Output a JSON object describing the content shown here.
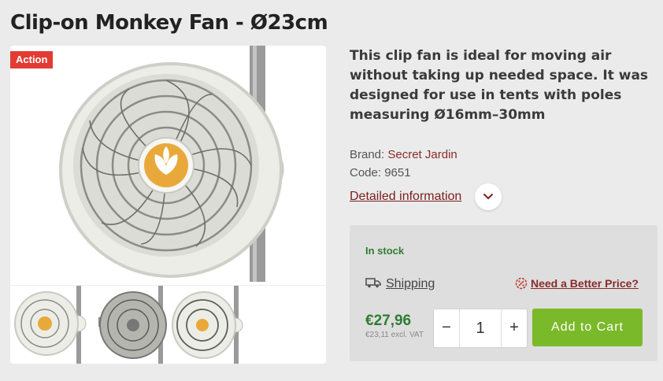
{
  "product": {
    "title": "Clip-on Monkey Fan - Ø23cm",
    "badge": "Action",
    "description": "This clip fan is ideal for moving air without taking up needed space. It was designed for use in tents with poles measuring Ø16mm–30mm",
    "brand_label": "Brand:",
    "brand_value": "Secret Jardin",
    "code_label": "Code:",
    "code_value": "9651",
    "details_label": "Detailed information"
  },
  "buybox": {
    "stock": "In stock",
    "shipping_label": "Shipping",
    "better_price_label": "Need a Better Price?",
    "price": "€27,96",
    "price_excl": "€23,11 excl. VAT",
    "quantity": "1",
    "minus": "−",
    "plus": "+",
    "cart_label": "Add to Cart"
  },
  "colors": {
    "badge": "#e23b34",
    "cart": "#7ab929",
    "price": "#2e7d32",
    "link": "#8b2a2a"
  },
  "icons": [
    "chevron-down-icon",
    "truck-icon",
    "percent-badge-icon"
  ]
}
